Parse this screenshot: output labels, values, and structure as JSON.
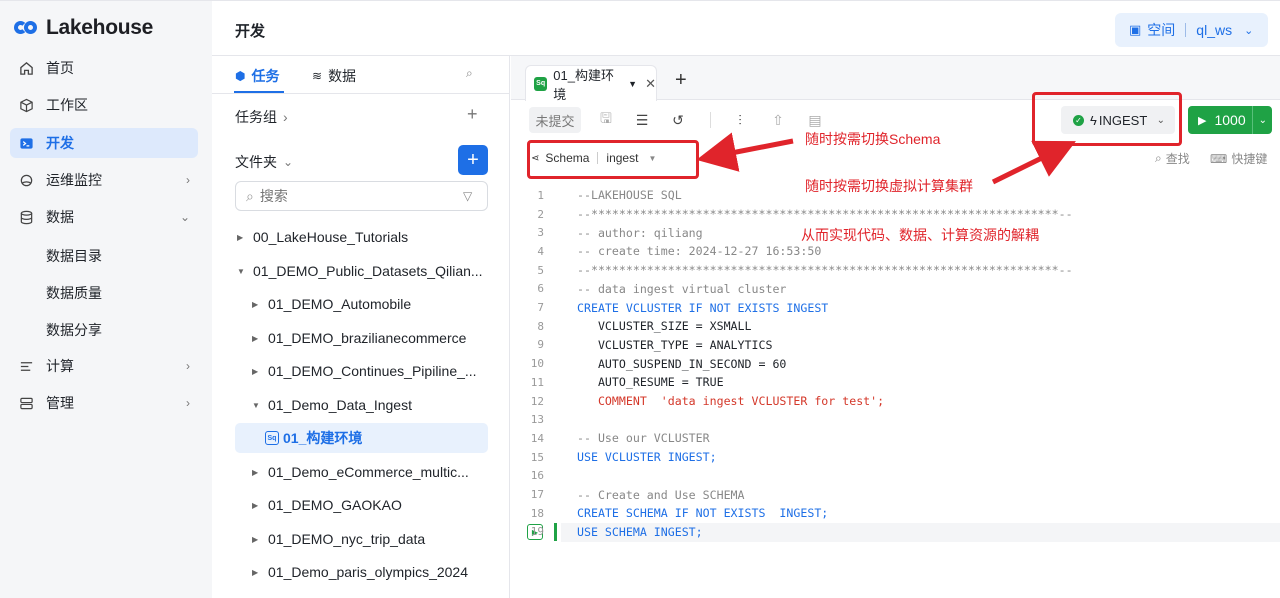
{
  "brand": {
    "name": "Lakehouse",
    "color": "#1e6fe6"
  },
  "nav": {
    "items": [
      {
        "label": "首页",
        "icon": "home-icon"
      },
      {
        "label": "工作区",
        "icon": "cube-icon"
      },
      {
        "label": "开发",
        "icon": "terminal-icon",
        "active": true
      },
      {
        "label": "运维监控",
        "icon": "monitor-icon",
        "expandable": true
      },
      {
        "label": "数据",
        "icon": "database-icon",
        "expanded": true
      },
      {
        "label": "计算",
        "icon": "compute-icon",
        "expandable": true
      },
      {
        "label": "管理",
        "icon": "admin-icon",
        "expandable": true
      }
    ],
    "data_sub": [
      "数据目录",
      "数据质量",
      "数据分享"
    ]
  },
  "header": {
    "title": "开发",
    "workspace_label": "空间",
    "workspace_value": "ql_ws"
  },
  "explorer": {
    "tab_tasks": "任务",
    "tab_data": "数据",
    "task_group": "任务组",
    "folder": "文件夹",
    "search_placeholder": "搜索",
    "tree": [
      "00_LakeHouse_Tutorials",
      "01_DEMO_Public_Datasets_Qilian...",
      "01_DEMO_Automobile",
      "01_DEMO_brazilianecommerce",
      "01_DEMO_Continues_Pipiline_...",
      "01_Demo_Data_Ingest",
      "01_构建环境",
      "01_Demo_eCommerce_multic...",
      "01_DEMO_GAOKAO",
      "01_DEMO_nyc_trip_data",
      "01_Demo_paris_olympics_2024"
    ]
  },
  "editor": {
    "tab_label": "01_构建环境",
    "tab_badge": "Sq",
    "draft_label": "未提交",
    "vcluster": "INGEST",
    "run_limit": "1000",
    "schema_label": "Schema",
    "schema_value": "ingest",
    "find_label": "查找",
    "shortcut_label": "快捷键",
    "status_color": "#1fa245"
  },
  "code_lines": [
    "--LAKEHOUSE SQL",
    "--*******************************************************************--",
    "-- author: qiliang",
    "-- create time: 2024-12-27 16:53:50",
    "--*******************************************************************--",
    "-- data ingest virtual cluster",
    "CREATE VCLUSTER IF NOT EXISTS INGEST",
    "   VCLUSTER_SIZE = XSMALL",
    "   VCLUSTER_TYPE = ANALYTICS",
    "   AUTO_SUSPEND_IN_SECOND = 60",
    "   AUTO_RESUME = TRUE",
    "   COMMENT  'data ingest VCLUSTER for test';",
    "",
    "-- Use our VCLUSTER",
    "USE VCLUSTER INGEST;",
    "",
    "-- Create and Use SCHEMA",
    "CREATE SCHEMA IF NOT EXISTS  INGEST;",
    "USE SCHEMA INGEST;"
  ],
  "line_numbers": [
    "1",
    "2",
    "3",
    "4",
    "5",
    "6",
    "7",
    "8",
    "9",
    "10",
    "11",
    "12",
    "13",
    "14",
    "15",
    "16",
    "17",
    "18",
    "19"
  ],
  "annotations": {
    "schema_note": "随时按需切换Schema",
    "vcluster_note": "随时按需切换虚拟计算集群",
    "decouple_note": "从而实现代码、数据、计算资源的解耦",
    "color": "#e0242b"
  }
}
